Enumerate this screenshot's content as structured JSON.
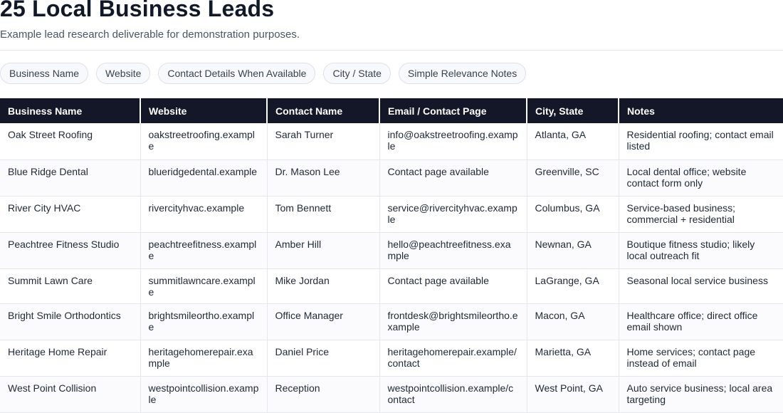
{
  "header": {
    "title": "25 Local Business Leads",
    "subtitle": "Example lead research deliverable for demonstration purposes."
  },
  "chips": [
    "Business Name",
    "Website",
    "Contact Details When Available",
    "City / State",
    "Simple Relevance Notes"
  ],
  "table": {
    "columns": [
      "Business Name",
      "Website",
      "Contact Name",
      "Email / Contact Page",
      "City, State",
      "Notes"
    ],
    "rows": [
      [
        "Oak Street Roofing",
        "oakstreetroofing.example",
        "Sarah Turner",
        "info@oakstreetroofing.example",
        "Atlanta, GA",
        "Residential roofing; contact email listed"
      ],
      [
        "Blue Ridge Dental",
        "blueridgedental.example",
        "Dr. Mason Lee",
        "Contact page available",
        "Greenville, SC",
        "Local dental office; website contact form only"
      ],
      [
        "River City HVAC",
        "rivercityhvac.example",
        "Tom Bennett",
        "service@rivercityhvac.example",
        "Columbus, GA",
        "Service-based business; commercial + residential"
      ],
      [
        "Peachtree Fitness Studio",
        "peachtreefitness.example",
        "Amber Hill",
        "hello@peachtreefitness.example",
        "Newnan, GA",
        "Boutique fitness studio; likely local outreach fit"
      ],
      [
        "Summit Lawn Care",
        "summitlawncare.example",
        "Mike Jordan",
        "Contact page available",
        "LaGrange, GA",
        "Seasonal local service business"
      ],
      [
        "Bright Smile Orthodontics",
        "brightsmileortho.example",
        "Office Manager",
        "frontdesk@brightsmileortho.example",
        "Macon, GA",
        "Healthcare office; direct office email shown"
      ],
      [
        "Heritage Home Repair",
        "heritagehomerepair.example",
        "Daniel Price",
        "heritagehomerepair.example/contact",
        "Marietta, GA",
        "Home services; contact page instead of email"
      ],
      [
        "West Point Collision",
        "westpointcollision.example",
        "Reception",
        "westpointcollision.example/contact",
        "West Point, GA",
        "Auto service business; local area targeting"
      ]
    ]
  }
}
